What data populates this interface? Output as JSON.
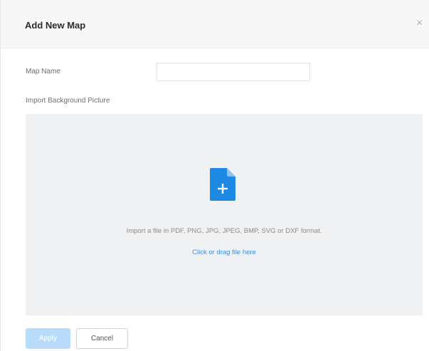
{
  "dialog": {
    "title": "Add New Map",
    "close_label": "×"
  },
  "form": {
    "map_name_label": "Map Name",
    "map_name_value": "",
    "map_name_placeholder": "",
    "import_label": "Import Background Picture"
  },
  "dropzone": {
    "icon": "file-add-icon",
    "hint": "Import a file in PDF, PNG, JPG, JPEG, BMP, SVG or DXF format.",
    "link": "Click or drag file here"
  },
  "actions": {
    "apply_label": "Apply",
    "cancel_label": "Cancel"
  },
  "colors": {
    "accent": "#1e88e5",
    "link": "#3a8ee6",
    "apply_disabled": "#b9dcfb",
    "dropzone_bg": "#f0f1f3"
  }
}
